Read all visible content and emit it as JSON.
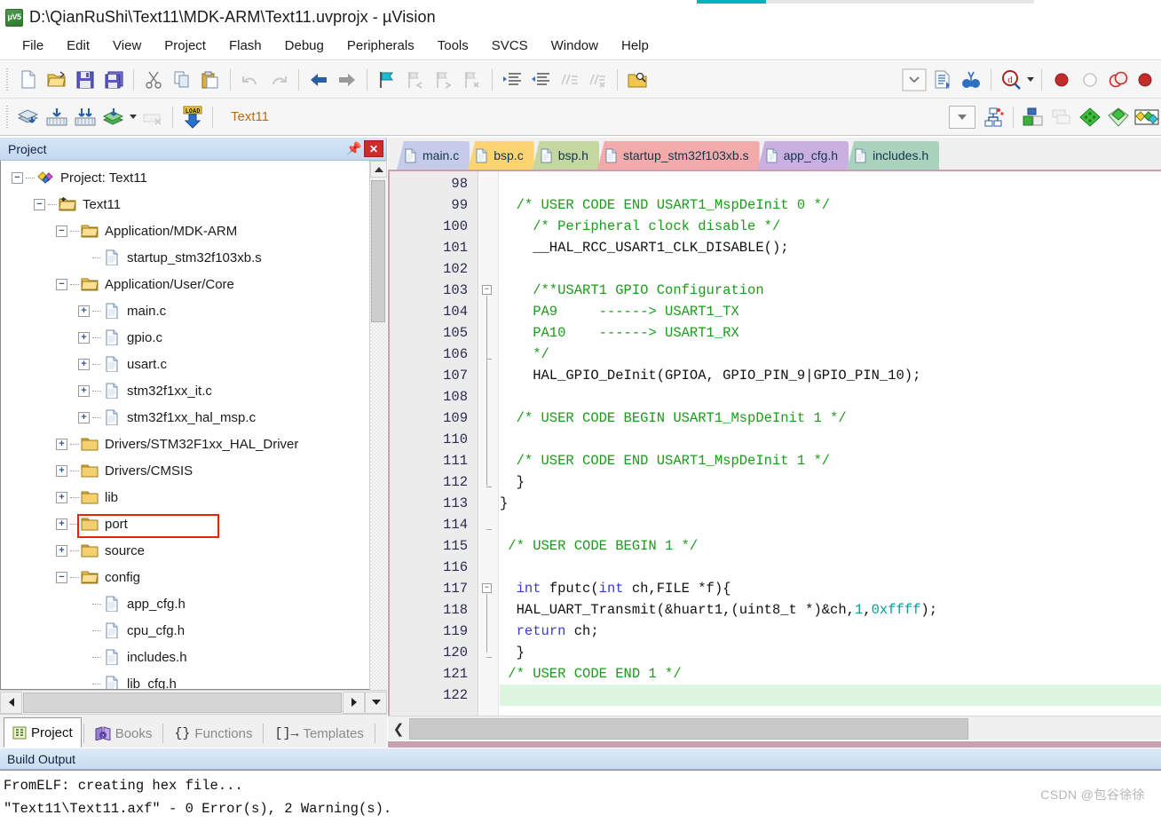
{
  "window": {
    "title": "D:\\QianRuShi\\Text11\\MDK-ARM\\Text11.uvprojx - µVision",
    "logo_text": "μV5"
  },
  "menu": {
    "items": [
      "File",
      "Edit",
      "View",
      "Project",
      "Flash",
      "Debug",
      "Peripherals",
      "Tools",
      "SVCS",
      "Window",
      "Help"
    ]
  },
  "toolbar_main": {
    "buttons": [
      {
        "name": "new-file-icon",
        "title": "New"
      },
      {
        "name": "open-file-icon",
        "title": "Open"
      },
      {
        "name": "save-icon",
        "title": "Save"
      },
      {
        "name": "save-all-icon",
        "title": "Save All"
      },
      {
        "name": "cut-icon",
        "title": "Cut"
      },
      {
        "name": "copy-icon",
        "title": "Copy"
      },
      {
        "name": "paste-icon",
        "title": "Paste"
      },
      {
        "name": "undo-icon",
        "title": "Undo"
      },
      {
        "name": "redo-icon",
        "title": "Redo"
      },
      {
        "name": "navigate-back-icon",
        "title": "Back"
      },
      {
        "name": "navigate-forward-icon",
        "title": "Forward"
      },
      {
        "name": "bookmark-toggle-icon",
        "title": "Insert/Remove Bookmark"
      },
      {
        "name": "bookmark-prev-icon",
        "title": "Previous Bookmark"
      },
      {
        "name": "bookmark-next-icon",
        "title": "Next Bookmark"
      },
      {
        "name": "bookmark-clear-icon",
        "title": "Clear All Bookmarks"
      },
      {
        "name": "indent-icon",
        "title": "Indent"
      },
      {
        "name": "outdent-icon",
        "title": "Outdent"
      },
      {
        "name": "comment-icon",
        "title": "Comment"
      },
      {
        "name": "uncomment-icon",
        "title": "Uncomment"
      },
      {
        "name": "find-in-files-icon",
        "title": "Find in Files"
      },
      {
        "name": "configure-dropdown-icon",
        "title": "Configure"
      },
      {
        "name": "insert-file-icon",
        "title": "Insert File"
      },
      {
        "name": "find-binoculars-icon",
        "title": "Find"
      },
      {
        "name": "debug-magnifier-icon",
        "title": "Debug"
      },
      {
        "name": "breakpoint-insert-icon",
        "title": "Insert/Remove Breakpoint"
      },
      {
        "name": "breakpoint-disable-icon",
        "title": "Enable/Disable Breakpoint"
      },
      {
        "name": "breakpoint-disable-all-icon",
        "title": "Disable All Breakpoints"
      },
      {
        "name": "breakpoint-kill-all-icon",
        "title": "Kill All Breakpoints"
      }
    ]
  },
  "toolbar_build": {
    "buttons": [
      {
        "name": "translate-icon",
        "title": "Translate"
      },
      {
        "name": "build-icon",
        "title": "Build"
      },
      {
        "name": "rebuild-icon",
        "title": "Rebuild"
      },
      {
        "name": "batch-build-icon",
        "title": "Batch Build"
      },
      {
        "name": "stop-build-icon",
        "title": "Stop Build"
      },
      {
        "name": "download-icon",
        "title": "Download",
        "label": "LOAD"
      },
      {
        "name": "target-options-icon",
        "title": "Options for Target"
      },
      {
        "name": "manage-run-env-icon",
        "title": "Manage Run-Time Environment"
      },
      {
        "name": "multi-project-icon",
        "title": "Manage Multi-Project"
      },
      {
        "name": "pack-installer-icon",
        "title": "Pack Installer"
      },
      {
        "name": "component-filter-icon",
        "title": "Filter"
      },
      {
        "name": "pack-manager-icon",
        "title": "Pack Manager"
      }
    ],
    "target_name": "Text11"
  },
  "project_panel": {
    "title": "Project",
    "pin_tooltip": "Auto Hide",
    "close_tooltip": "Close",
    "tree": [
      {
        "label": "Project: Text11",
        "depth": 0,
        "expander": "minus",
        "icon": "project-icon"
      },
      {
        "label": "Text11",
        "depth": 1,
        "expander": "minus",
        "icon": "target-folder-icon"
      },
      {
        "label": "Application/MDK-ARM",
        "depth": 2,
        "expander": "minus",
        "icon": "folder-open-icon"
      },
      {
        "label": "startup_stm32f103xb.s",
        "depth": 3,
        "expander": "none",
        "icon": "file-icon"
      },
      {
        "label": "Application/User/Core",
        "depth": 2,
        "expander": "minus",
        "icon": "folder-open-icon"
      },
      {
        "label": "main.c",
        "depth": 3,
        "expander": "plus",
        "icon": "file-icon"
      },
      {
        "label": "gpio.c",
        "depth": 3,
        "expander": "plus",
        "icon": "file-icon"
      },
      {
        "label": "usart.c",
        "depth": 3,
        "expander": "plus",
        "icon": "file-icon",
        "highlighted": true
      },
      {
        "label": "stm32f1xx_it.c",
        "depth": 3,
        "expander": "plus",
        "icon": "file-icon"
      },
      {
        "label": "stm32f1xx_hal_msp.c",
        "depth": 3,
        "expander": "plus",
        "icon": "file-icon"
      },
      {
        "label": "Drivers/STM32F1xx_HAL_Driver",
        "depth": 2,
        "expander": "plus",
        "icon": "folder-closed-icon"
      },
      {
        "label": "Drivers/CMSIS",
        "depth": 2,
        "expander": "plus",
        "icon": "folder-closed-icon"
      },
      {
        "label": "lib",
        "depth": 2,
        "expander": "plus",
        "icon": "folder-closed-icon"
      },
      {
        "label": "port",
        "depth": 2,
        "expander": "plus",
        "icon": "folder-closed-icon"
      },
      {
        "label": "source",
        "depth": 2,
        "expander": "plus",
        "icon": "folder-closed-icon"
      },
      {
        "label": "config",
        "depth": 2,
        "expander": "minus",
        "icon": "folder-open-icon"
      },
      {
        "label": "app_cfg.h",
        "depth": 3,
        "expander": "none",
        "icon": "file-icon"
      },
      {
        "label": "cpu_cfg.h",
        "depth": 3,
        "expander": "none",
        "icon": "file-icon"
      },
      {
        "label": "includes.h",
        "depth": 3,
        "expander": "none",
        "icon": "file-icon"
      },
      {
        "label": "lib_cfg.h",
        "depth": 3,
        "expander": "none",
        "icon": "file-icon"
      }
    ]
  },
  "left_tabs": [
    {
      "label": "Project",
      "icon": "project-tab-icon",
      "active": true
    },
    {
      "label": "Books",
      "icon": "books-icon",
      "active": false
    },
    {
      "label": "Functions",
      "icon": "functions-icon",
      "active": false
    },
    {
      "label": "Templates",
      "icon": "templates-icon",
      "active": false
    }
  ],
  "editor_tabs": [
    {
      "label": "main.c",
      "color": "#c5cbe8",
      "active": true
    },
    {
      "label": "bsp.c",
      "color": "#fdd472",
      "active": false
    },
    {
      "label": "bsp.h",
      "color": "#c5d7a0",
      "active": false
    },
    {
      "label": "startup_stm32f103xb.s",
      "color": "#f3aaaa",
      "active": false
    },
    {
      "label": "app_cfg.h",
      "color": "#c9b0e0",
      "active": false
    },
    {
      "label": "includes.h",
      "color": "#a9d3bd",
      "active": false
    }
  ],
  "code": {
    "lines": [
      {
        "n": "98",
        "segs": []
      },
      {
        "n": "99",
        "segs": [
          {
            "t": "  /* USER CODE END USART1_MspDeInit 0 */",
            "c": "cmt"
          }
        ]
      },
      {
        "n": "100",
        "segs": [
          {
            "t": "    /* Peripheral clock disable */",
            "c": "cmt"
          }
        ]
      },
      {
        "n": "101",
        "segs": [
          {
            "t": "    __HAL_RCC_USART1_CLK_DISABLE();",
            "c": "pln"
          }
        ]
      },
      {
        "n": "102",
        "segs": []
      },
      {
        "n": "103",
        "segs": [
          {
            "t": "    /**USART1 GPIO Configuration",
            "c": "cmt"
          }
        ],
        "fold": "open"
      },
      {
        "n": "104",
        "segs": [
          {
            "t": "    PA9     ------> USART1_TX",
            "c": "cmt"
          }
        ]
      },
      {
        "n": "105",
        "segs": [
          {
            "t": "    PA10    ------> USART1_RX",
            "c": "cmt"
          }
        ]
      },
      {
        "n": "106",
        "segs": [
          {
            "t": "    */",
            "c": "cmt"
          }
        ],
        "fold": "end"
      },
      {
        "n": "107",
        "segs": [
          {
            "t": "    HAL_GPIO_DeInit(GPIOA, GPIO_PIN_9|GPIO_PIN_10);",
            "c": "pln"
          }
        ]
      },
      {
        "n": "108",
        "segs": []
      },
      {
        "n": "109",
        "segs": [
          {
            "t": "  /* USER CODE BEGIN USART1_MspDeInit 1 */",
            "c": "cmt"
          }
        ]
      },
      {
        "n": "110",
        "segs": []
      },
      {
        "n": "111",
        "segs": [
          {
            "t": "  /* USER CODE END USART1_MspDeInit 1 */",
            "c": "cmt"
          }
        ]
      },
      {
        "n": "112",
        "segs": [
          {
            "t": "  }",
            "c": "pln"
          }
        ],
        "fold": "end"
      },
      {
        "n": "113",
        "segs": [
          {
            "t": "}",
            "c": "pln"
          }
        ]
      },
      {
        "n": "114",
        "segs": [],
        "fold": "end"
      },
      {
        "n": "115",
        "segs": [
          {
            "t": " /* USER CODE BEGIN 1 */",
            "c": "cmt"
          }
        ]
      },
      {
        "n": "116",
        "segs": []
      },
      {
        "n": "117",
        "segs": [
          {
            "t": "  ",
            "c": "pln"
          },
          {
            "t": "int",
            "c": "kw"
          },
          {
            "t": " fputc(",
            "c": "pln"
          },
          {
            "t": "int",
            "c": "kw"
          },
          {
            "t": " ch,FILE *f){",
            "c": "pln"
          }
        ],
        "fold": "open"
      },
      {
        "n": "118",
        "segs": [
          {
            "t": "  HAL_UART_Transmit(&huart1,(uint8_t *)&ch,",
            "c": "pln"
          },
          {
            "t": "1",
            "c": "num"
          },
          {
            "t": ",",
            "c": "pln"
          },
          {
            "t": "0xffff",
            "c": "num"
          },
          {
            "t": ");",
            "c": "pln"
          }
        ]
      },
      {
        "n": "119",
        "segs": [
          {
            "t": "  ",
            "c": "pln"
          },
          {
            "t": "return",
            "c": "kw"
          },
          {
            "t": " ch;",
            "c": "pln"
          }
        ]
      },
      {
        "n": "120",
        "segs": [
          {
            "t": "  }",
            "c": "pln"
          }
        ],
        "fold": "end"
      },
      {
        "n": "121",
        "segs": [
          {
            "t": " /* USER CODE END 1 */",
            "c": "cmt"
          }
        ]
      },
      {
        "n": "122",
        "segs": [],
        "highlight": true
      }
    ]
  },
  "build_output": {
    "title": "Build Output",
    "lines": [
      "FromELF: creating hex file...",
      "\"Text11\\Text11.axf\" - 0 Error(s), 2 Warning(s)."
    ]
  },
  "watermark": "CSDN @包谷徐徐",
  "colors": {
    "accent_teal": "#00b3bd",
    "marker_red": "#ee2200",
    "comment_green": "#1a9c1a",
    "keyword_blue": "#3b3bcf",
    "number_teal": "#0a9a9a",
    "highlight_green": "#ddf6dd",
    "panel_blue": "#c9dcf0"
  }
}
